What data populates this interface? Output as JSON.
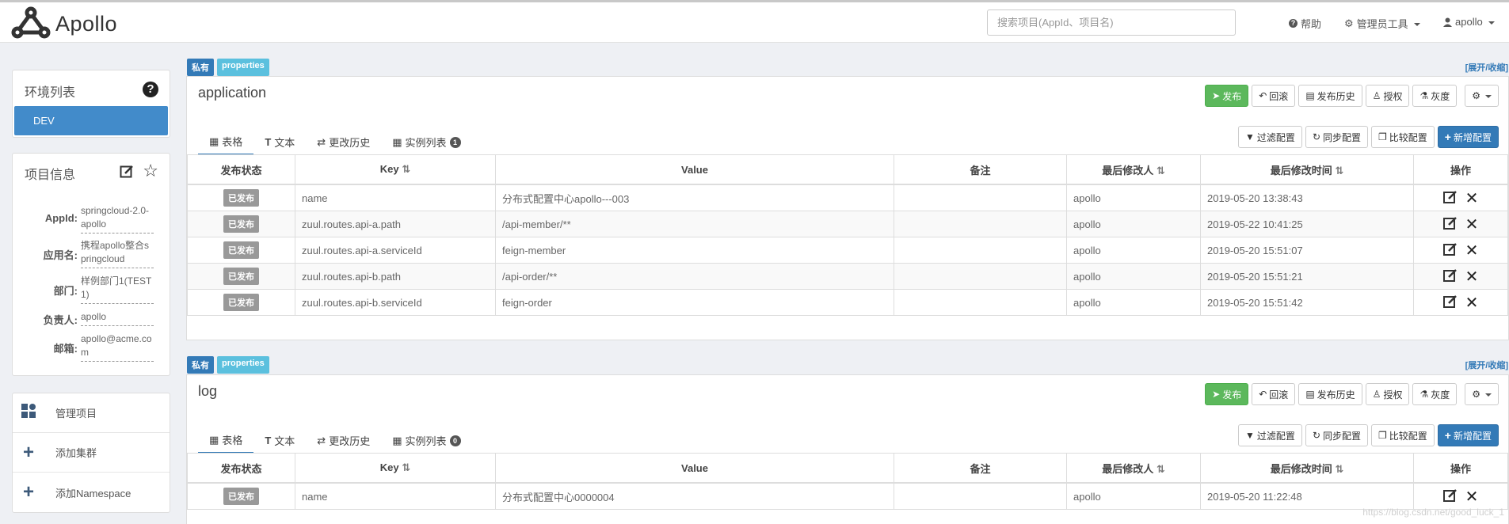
{
  "navbar": {
    "brand": "Apollo",
    "search_placeholder": "搜索项目(AppId、项目名)",
    "help": "帮助",
    "admin_tools": "管理员工具",
    "user": "apollo"
  },
  "sidebar": {
    "env_title": "环境列表",
    "envs": [
      "DEV"
    ],
    "project_title": "项目信息",
    "project_info": [
      {
        "label": "AppId:",
        "value": "springcloud-2.0-apollo"
      },
      {
        "label": "应用名:",
        "value": "携程apollo整合springcloud"
      },
      {
        "label": "部门:",
        "value": "样例部门1(TEST1)"
      },
      {
        "label": "负责人:",
        "value": "apollo"
      },
      {
        "label": "邮箱:",
        "value": "apollo@acme.com"
      }
    ],
    "actions": [
      "管理项目",
      "添加集群",
      "添加Namespace"
    ]
  },
  "namespace_common": {
    "tag_private": "私有",
    "tag_format": "properties",
    "toggle": "[展开/收缩]",
    "buttons": {
      "publish": "发布",
      "rollback": "回滚",
      "history": "发布历史",
      "grant": "授权",
      "gray": "灰度"
    },
    "tabs": {
      "table": "表格",
      "text": "文本",
      "history": "更改历史",
      "instances": "实例列表"
    },
    "tools": {
      "filter": "过滤配置",
      "sync": "同步配置",
      "compare": "比较配置",
      "add": "新增配置"
    },
    "columns": {
      "status": "发布状态",
      "key": "Key",
      "value": "Value",
      "comment": "备注",
      "modifier": "最后修改人",
      "time": "最后修改时间",
      "ops": "操作"
    },
    "status_published": "已发布"
  },
  "namespaces": [
    {
      "name": "application",
      "instance_count": "1",
      "rows": [
        {
          "key": "name",
          "value": "分布式配置中心apollo---003",
          "comment": "",
          "modifier": "apollo",
          "time": "2019-05-20 13:38:43"
        },
        {
          "key": "zuul.routes.api-a.path",
          "value": "/api-member/**",
          "comment": "",
          "modifier": "apollo",
          "time": "2019-05-22 10:41:25"
        },
        {
          "key": "zuul.routes.api-a.serviceId",
          "value": "feign-member",
          "comment": "",
          "modifier": "apollo",
          "time": "2019-05-20 15:51:07"
        },
        {
          "key": "zuul.routes.api-b.path",
          "value": "/api-order/**",
          "comment": "",
          "modifier": "apollo",
          "time": "2019-05-20 15:51:21"
        },
        {
          "key": "zuul.routes.api-b.serviceId",
          "value": "feign-order",
          "comment": "",
          "modifier": "apollo",
          "time": "2019-05-20 15:51:42"
        }
      ]
    },
    {
      "name": "log",
      "instance_count": "0",
      "rows": [
        {
          "key": "name",
          "value": "分布式配置中心0000004",
          "comment": "",
          "modifier": "apollo",
          "time": "2019-05-20 11:22:48"
        }
      ]
    }
  ],
  "watermark": "https://blog.csdn.net/good_luck_1"
}
